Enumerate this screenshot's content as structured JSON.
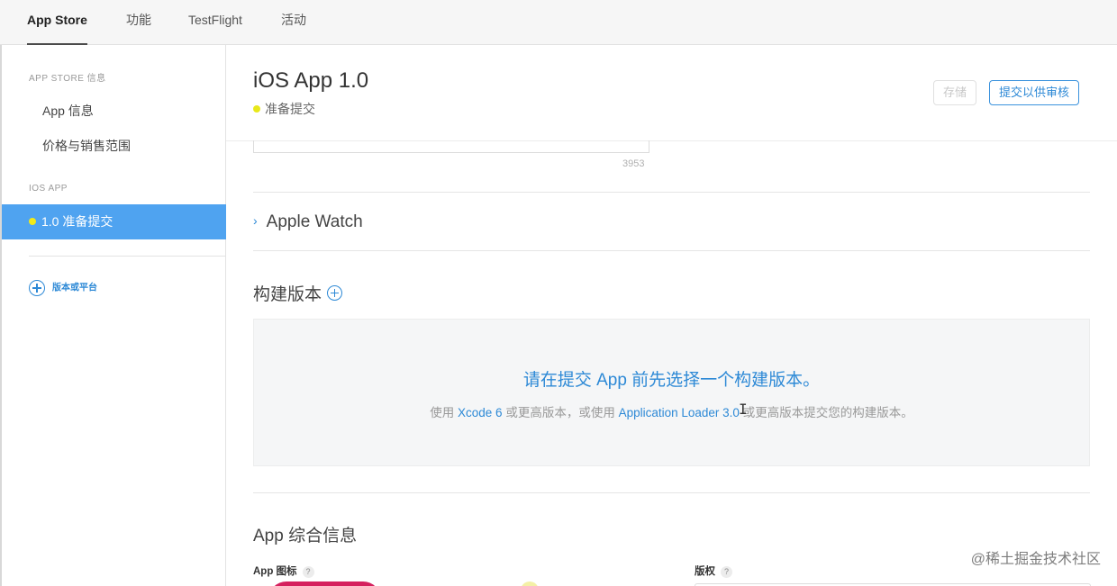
{
  "tabs": [
    {
      "label": "App Store",
      "active": true
    },
    {
      "label": "功能",
      "active": false
    },
    {
      "label": "TestFlight",
      "active": false
    },
    {
      "label": "活动",
      "active": false
    }
  ],
  "sidebar": {
    "section_store": "APP STORE 信息",
    "items": [
      {
        "label": "App 信息"
      },
      {
        "label": "价格与销售范围"
      }
    ],
    "section_ios": "IOS APP",
    "active_version": "1.0 准备提交",
    "add_label": "版本或平台"
  },
  "header": {
    "title": "iOS App 1.0",
    "status": "准备提交",
    "save_label": "存储",
    "submit_label": "提交以供审核"
  },
  "content": {
    "char_count": "3953",
    "apple_watch_label": "Apple Watch",
    "build_title": "构建版本",
    "build_msg": "请在提交 App 前先选择一个构建版本。",
    "build_sub_1": "使用 ",
    "build_sub_xcode": "Xcode 6",
    "build_sub_2": " 或更高版本，或使用 ",
    "build_sub_loader": "Application Loader 3.0",
    "build_sub_3": " 或更高版本提交您的构建版本。",
    "cursor_glyph": "I",
    "general_title": "App 综合信息",
    "icon_label": "App 图标",
    "copyright_label": "版权",
    "help_glyph": "?"
  },
  "watermark": "@稀土掘金技术社区",
  "colors": {
    "accent": "#2d89d6",
    "sidebar_active": "#4fa3f0",
    "status_dot": "#e8e81a"
  }
}
